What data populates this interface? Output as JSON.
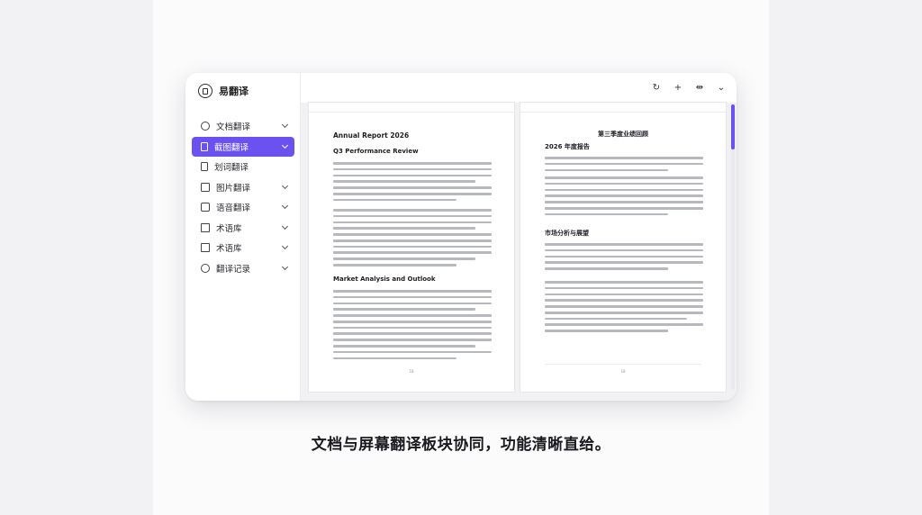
{
  "app": {
    "name": "易翻译"
  },
  "topbar": {
    "refresh_icon": "↻",
    "add_icon": "+",
    "split_icon": "⇹",
    "more_icon": "⌄"
  },
  "sidebar": {
    "items": [
      {
        "label": "文档翻译",
        "icon": "circle-icon",
        "expandable": true,
        "active": false
      },
      {
        "label": "截图翻译",
        "icon": "doc-icon",
        "expandable": true,
        "active": true
      },
      {
        "label": "划词翻译",
        "icon": "doc-icon",
        "expandable": false,
        "active": false
      },
      {
        "label": "图片翻译",
        "icon": "image-icon",
        "expandable": true,
        "active": false
      },
      {
        "label": "语音翻译",
        "icon": "mic-icon",
        "expandable": true,
        "active": false
      },
      {
        "label": "术语库",
        "icon": "book-icon",
        "expandable": true,
        "active": false
      },
      {
        "label": "术语库",
        "icon": "book-icon",
        "expandable": true,
        "active": false
      },
      {
        "label": "翻译记录",
        "icon": "clock-icon",
        "expandable": true,
        "active": false
      }
    ],
    "accent": "#6b52f0"
  },
  "left_page": {
    "title": "Annual Report 2026",
    "h2_1": "Q3 Performance Review",
    "h2_2": "Market Analysis and Outlook",
    "page_number": "18"
  },
  "right_page": {
    "title": "第三季度业绩回顾",
    "h2_1": "2026 年度报告",
    "h2_2": "市场分析与展望",
    "page_number": "18"
  },
  "caption": "文档与屏幕翻译板块协同，功能清晰直给。"
}
